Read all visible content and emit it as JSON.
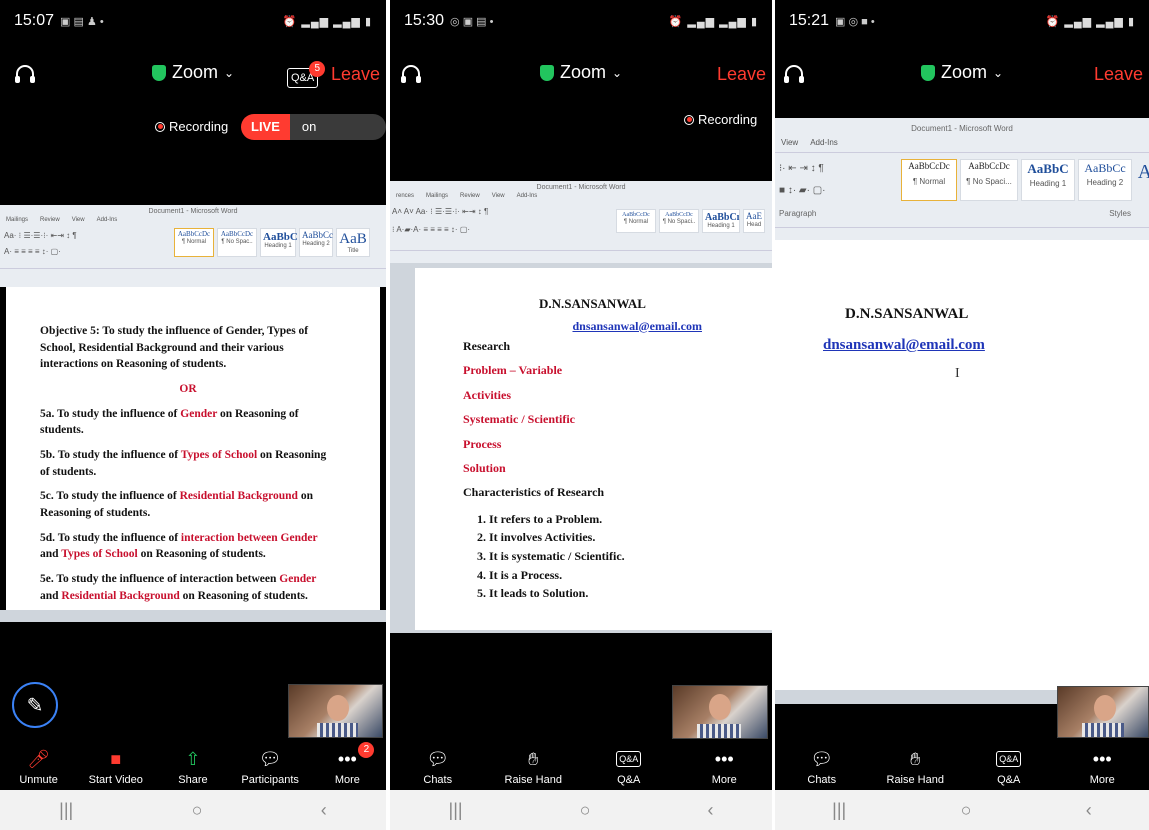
{
  "panel1": {
    "time": "15:07",
    "zoom_label": "Zoom",
    "leave": "Leave",
    "qa_label": "Q&A",
    "qa_badge": "5",
    "recording": "Recording",
    "live": "LIVE",
    "on_facebook": "on Facebook",
    "doc": {
      "objective": "Objective 5: To study the influence of Gender, Types of School, Residential Background and their various interactions on Reasoning of students.",
      "or": "OR",
      "items": [
        {
          "pre": "5a. To study the influence of ",
          "red1": "Gender",
          "mid": " on Reasoning of students.",
          "red2": "",
          "post": ""
        },
        {
          "pre": "5b. To study the influence of ",
          "red1": "Types of School",
          "mid": " on Reasoning of students.",
          "red2": "",
          "post": ""
        },
        {
          "pre": "5c. To study the influence of ",
          "red1": "Residential Background",
          "mid": " on Reasoning of students.",
          "red2": "",
          "post": ""
        },
        {
          "pre": "5d. To study the influence of ",
          "red1": "interaction between Gender",
          "mid": " and ",
          "red2": "Types of School",
          "post": " on Reasoning of students."
        },
        {
          "pre": "5e. To study the influence of interaction between ",
          "red1": "Gender",
          "mid": " and ",
          "red2": "Residential Background",
          "post": " on Reasoning of students."
        }
      ]
    },
    "bottom": {
      "unmute": "Unmute",
      "start_video": "Start Video",
      "share": "Share",
      "participants": "Participants",
      "more": "More",
      "more_badge": "2"
    }
  },
  "panel2": {
    "time": "15:30",
    "zoom_label": "Zoom",
    "leave": "Leave",
    "recording": "Recording",
    "word_title": "Document1 - Microsoft Word",
    "doc": {
      "name": "D.N.SANSANWAL",
      "email": "dnsansanwal@email.com",
      "research": "Research",
      "red_lines": [
        "Problem – Variable",
        "Activities",
        "Systematic / Scientific",
        "Process",
        "Solution"
      ],
      "char_title": "Characteristics of Research",
      "list": [
        "1. It refers to a Problem.",
        "2. It involves Activities.",
        "3. It is systematic / Scientific.",
        "4. It is a Process.",
        "5. It leads to Solution."
      ]
    },
    "bottom": {
      "chats": "Chats",
      "raise_hand": "Raise Hand",
      "qa": "Q&A",
      "more": "More"
    }
  },
  "panel3": {
    "time": "15:21",
    "zoom_label": "Zoom",
    "leave": "Leave",
    "word_title": "Document1 - Microsoft Word",
    "tab_view": "View",
    "tab_addins": "Add-Ins",
    "group_paragraph": "Paragraph",
    "group_styles": "Styles",
    "styles": [
      {
        "sample": "AaBbCcDc",
        "name": "¶ Normal"
      },
      {
        "sample": "AaBbCcDc",
        "name": "¶ No Spaci..."
      },
      {
        "sample": "AaBbC",
        "name": "Heading 1"
      },
      {
        "sample": "AaBbCc",
        "name": "Heading 2"
      }
    ],
    "doc": {
      "name": "D.N.SANSANWAL",
      "email": "dnsansanwal@email.com"
    },
    "bottom": {
      "chats": "Chats",
      "raise_hand": "Raise Hand",
      "qa": "Q&A",
      "more": "More"
    }
  },
  "colors": {
    "accent_red": "#ff3b30",
    "zoom_green": "#22c55e",
    "doc_red": "#c8102e",
    "link_blue": "#1f35b8"
  },
  "icons": [
    "headset-icon",
    "shield-icon",
    "chevron-down-icon",
    "mic-off-icon",
    "video-off-icon",
    "share-icon",
    "participants-icon",
    "more-icon",
    "chat-icon",
    "raise-hand-icon",
    "pencil-icon",
    "record-icon"
  ]
}
